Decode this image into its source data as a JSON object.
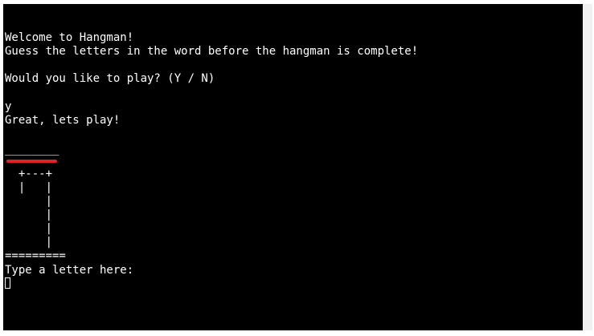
{
  "terminal": {
    "welcome": "Welcome to Hangman!",
    "instructions": "Guess the letters in the word before the hangman is complete!",
    "prompt_play": "Would you like to play? (Y / N)",
    "user_answer": "y",
    "response": "Great, lets play!",
    "word_blanks": "________",
    "gallows": [
      "  +---+",
      "  |   |",
      "      |",
      "      |",
      "      |",
      "      |",
      "========="
    ],
    "letter_prompt": "Type a letter here:"
  },
  "colors": {
    "background": "#000000",
    "text": "#ffffff",
    "accent_bar": "#e02323"
  }
}
